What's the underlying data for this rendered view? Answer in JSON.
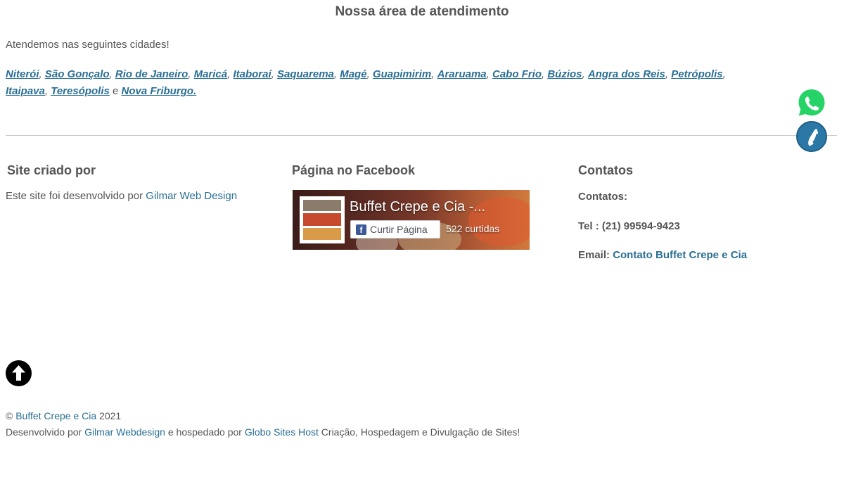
{
  "area": {
    "title": "Nossa área de atendimento",
    "intro": "Atendemos nas seguintes cidades!",
    "cities_line1": [
      "Niterói",
      "São Gonçalo",
      "Rio de Janeiro",
      "Maricá",
      "Itaboraí",
      "Saquarema",
      "Magé",
      "Guapimirim",
      "Araruama",
      "Cabo Frio",
      "Búzios",
      "Angra dos Reis",
      "Petrópolis"
    ],
    "cities_line2": [
      "Itaipava",
      "Teresópolis"
    ],
    "last_city": "Nova Friburgo.",
    "separator": ",",
    "and_word": "e"
  },
  "footer_cols": {
    "col1": {
      "heading": "Site criado por",
      "text": "Este site foi desenvolvido por",
      "link": "Gilmar Web Design"
    },
    "col2": {
      "heading": "Página no Facebook",
      "page_name": "Buffet Crepe e Cia -...",
      "like_label": "Curtir Página",
      "like_count": "522 curtidas"
    },
    "col3": {
      "heading": "Contatos",
      "label": "Contatos:",
      "tel": "Tel : (21) 99594-9423",
      "email_label": "Email:",
      "email_link": "Contato Buffet Crepe e Cia"
    }
  },
  "copyright": {
    "symbol": "©",
    "site_link": "Buffet Crepe e Cia",
    "year": "2021",
    "dev_prefix": "Desenvolvido por",
    "dev_link": "Gilmar Webdesign",
    "host_prefix": "e hospedado por",
    "host_link": "Globo Sites Host",
    "host_suffix": "Criação, Hospedagem e Divulgação de Sites!"
  },
  "icons": {
    "whatsapp": "whatsapp-icon",
    "phone": "phone-icon",
    "scroll_top": "arrow-up-icon",
    "facebook": "facebook-icon"
  },
  "colors": {
    "link": "#2a6f94",
    "text": "#555555",
    "whatsapp": "#25d366",
    "phone": "#2b78a6",
    "facebook": "#3b5998"
  }
}
